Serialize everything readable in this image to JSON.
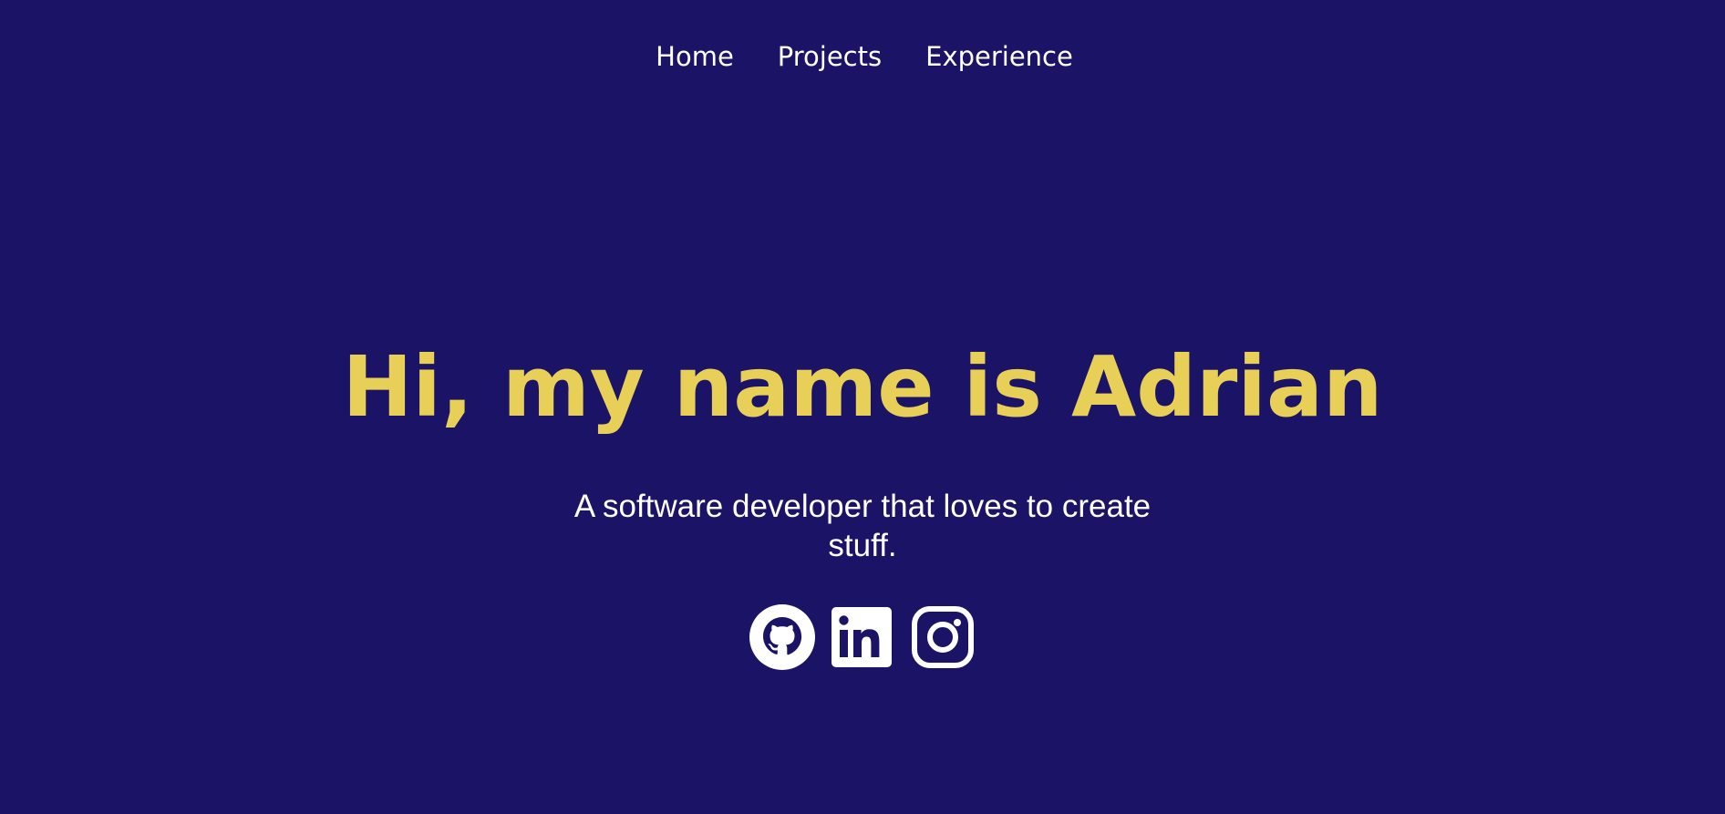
{
  "nav": {
    "items": [
      {
        "label": "Home"
      },
      {
        "label": "Projects"
      },
      {
        "label": "Experience"
      }
    ]
  },
  "hero": {
    "title": "Hi, my name is Adrian",
    "subtitle": "A software developer that loves to create stuff."
  },
  "socials": [
    {
      "icon": "github-icon"
    },
    {
      "icon": "linkedin-icon"
    },
    {
      "icon": "instagram-icon"
    }
  ],
  "colors": {
    "background": "#1b1366",
    "accent": "#e8cf57",
    "text": "#ffffff"
  }
}
